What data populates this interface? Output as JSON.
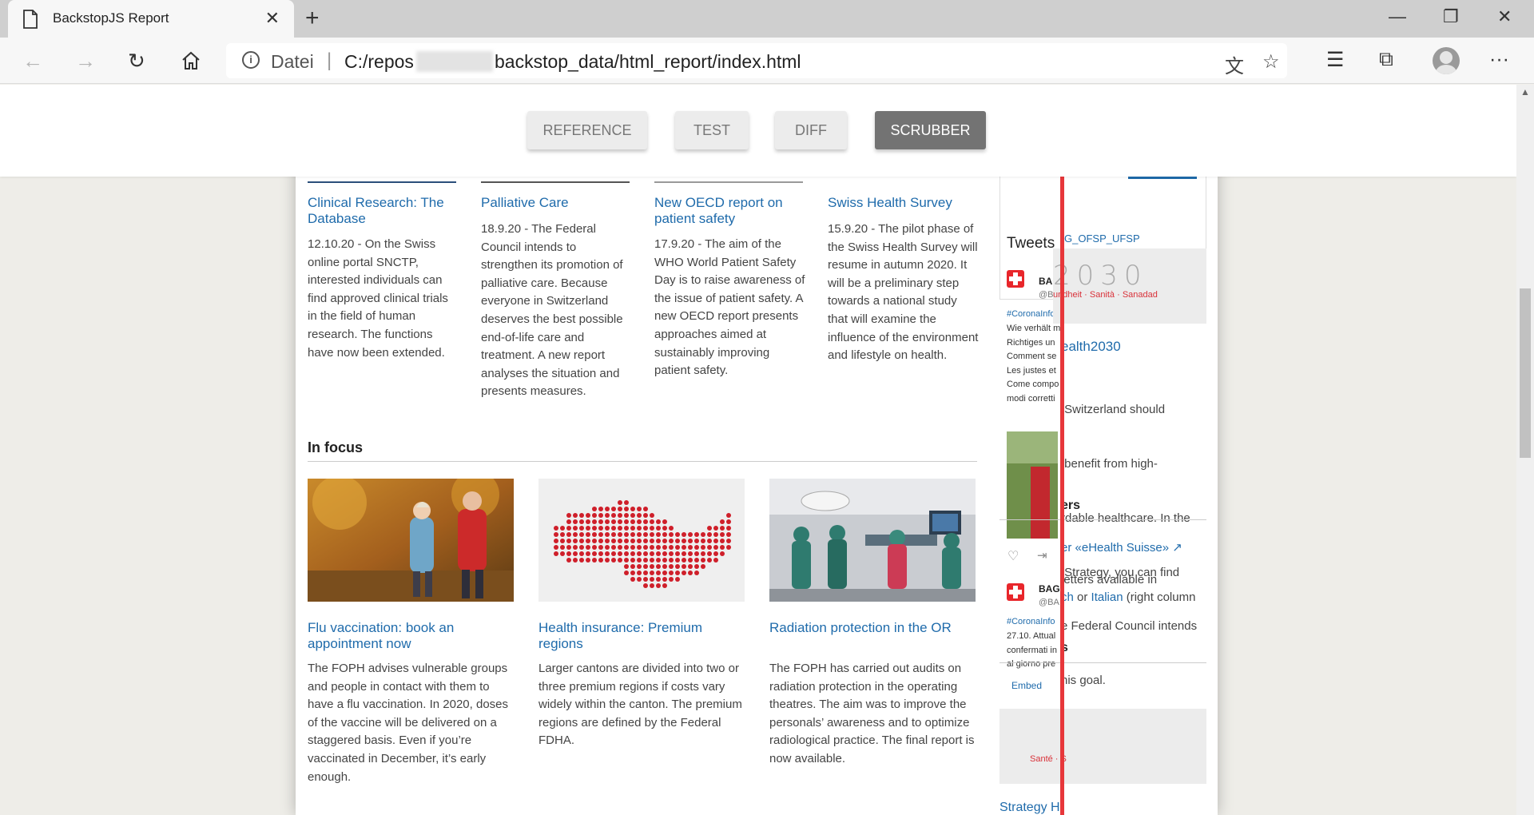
{
  "browser": {
    "tab_title": "BackstopJS Report",
    "address_label": "Datei",
    "address_url_start": "C:/repos",
    "address_url_end": "backstop_data/html_report/index.html"
  },
  "backstop": {
    "buttons": [
      {
        "label": "REFERENCE"
      },
      {
        "label": "TEST"
      },
      {
        "label": "DIFF"
      },
      {
        "label": "SCRUBBER"
      }
    ]
  },
  "news": [
    {
      "title": "Clinical Research: The Database",
      "text": "12.10.20 - On the Swiss online portal SNCTP, interested individuals can find approved clinical trials in the field of human research. The functions have now been extended."
    },
    {
      "title": "Palliative Care",
      "text": "18.9.20 - The Federal Council intends to strengthen its promotion of palliative care. Because everyone in Switzerland deserves the best possible end-of-life care and treatment. A new report analyses the situation and presents measures."
    },
    {
      "title": "New OECD report on patient safety",
      "text": "17.9.20 - The aim of the WHO World Patient Safety Day is to raise awareness of the issue of patient safety. A new OECD report presents approaches aimed at sustainably improving patient safety."
    },
    {
      "title": "Swiss Health Survey",
      "text": "15.9.20 - The pilot phase of the Swiss Health Survey will resume in autumn 2020. It will be a preliminary step towards a national study that will examine the influence of the environment and lifestyle on health."
    }
  ],
  "in_focus": {
    "heading": "In focus",
    "items": [
      {
        "title": "Flu vaccination: book an appointment now",
        "text": "The FOPH advises vulnerable groups and people in contact with them to have a flu vaccination. In 2020, doses of the vaccine will be delivered on a staggered basis. Even if you’re vaccinated in December, it’s early enough."
      },
      {
        "title": "Health insurance: Premium regions",
        "text": "Larger cantons are divided into two or three premium regions if costs vary widely within the canton. The premium regions are defined by the Federal FDHA."
      },
      {
        "title": "Radiation protection in the OR",
        "text": "The FOPH has carried out audits on radiation protection in the operating theatres. The aim was to improve the personals’ awareness and to optimize radiological practice. The final report is now available."
      }
    ]
  },
  "right_column": {
    "tweets_heading": "Tweets",
    "tweet_by": "G_OFSP_UFSP",
    "tweet1_name": "BAG",
    "tweet1_handle": "@BA",
    "tweet1_tag": "#CoronaInfo",
    "tweet1_lines": [
      "Wie verhält m",
      "Richtiges un",
      "Comment se",
      "Les justes et",
      "Come compo",
      "modi corretti"
    ],
    "tweet2_name": "BAG",
    "tweet2_handle": "@BA",
    "tweet2_tag": "#CoronaInfo",
    "tweet2_lines": [
      "27.10. Attual",
      "confermati in",
      "al giorno pre"
    ],
    "embed_label": "Embed",
    "banner_text": "undheit · Sanità · Sanadad",
    "banner_2030": "2030",
    "health2030_title": "ealth2030",
    "health2030_text": [
      " Switzerland should",
      " benefit from high-",
      "rdable healthcare. In the",
      " Strategy, you can find",
      "e Federal Council intends",
      "his goal."
    ],
    "letters_heading": "ers",
    "newsletter_link": "er «eHealth Suisse»",
    "newsletter_line1": "letters available in",
    "newsletter_fr": "ch",
    "newsletter_or": " or ",
    "newsletter_it": "Italian",
    "newsletter_rest": " (right column",
    "section_s": "s",
    "sante_label": "Santé · S",
    "strategy_label": "Strategy H"
  }
}
